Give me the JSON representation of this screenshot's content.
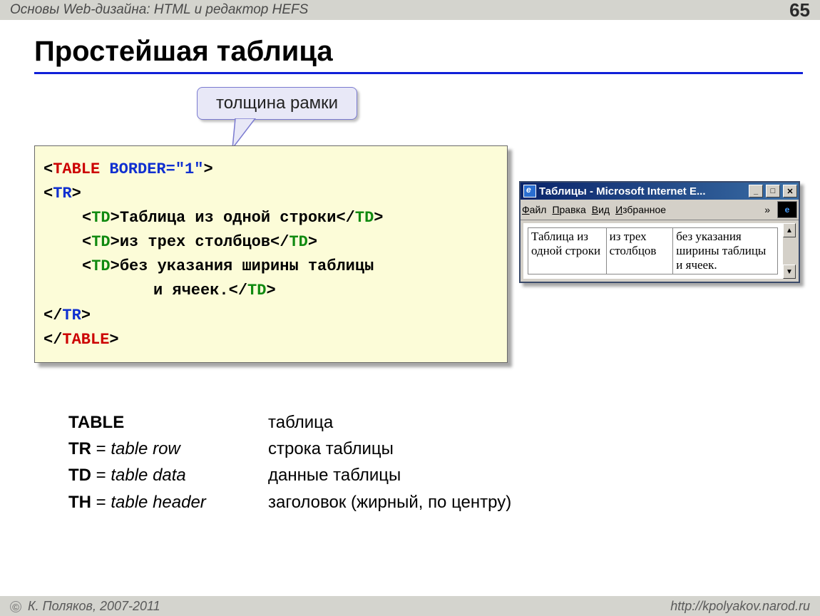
{
  "header": {
    "breadcrumb": "Основы Web-дизайна: HTML и редактор HEFS",
    "page_number": "65"
  },
  "title": "Простейшая таблица",
  "callout": "толщина рамки",
  "code": {
    "l1_a": "<TABLE",
    "l1_b": " BORDER=\"1\"",
    "l1_c": ">",
    "l2": "<TR>",
    "l3_a": "<TD>",
    "l3_b": "Таблица из одной строки",
    "l3_c": "</TD>",
    "l4_a": "<TD>",
    "l4_b": "из трех столбцов",
    "l4_c": "</TD>",
    "l5_a": "<TD>",
    "l5_b": "без указания ширины таблицы",
    "l6_b": "и ячеек.",
    "l6_c": "</TD>",
    "l7": "</TR>",
    "l8": "</TABLE>"
  },
  "ie": {
    "title": "Таблицы - Microsoft Internet E...",
    "menu": {
      "file": "Файл",
      "edit": "Правка",
      "view": "Вид",
      "fav": "Избранное",
      "chev": "»"
    },
    "cells": {
      "c1": "Таблица из одной строки",
      "c2": "из трех столбцов",
      "c3": "без указания ширины таблицы и ячеек."
    },
    "btn_min": "_",
    "btn_max": "□",
    "btn_close": "✕",
    "arrow_up": "▲",
    "arrow_down": "▼"
  },
  "defs": [
    {
      "tag": "TABLE",
      "eq": "",
      "eng": "",
      "ru": "таблица"
    },
    {
      "tag": "TR",
      "eq": " = ",
      "eng": "table row",
      "ru": "строка таблицы"
    },
    {
      "tag": "TD",
      "eq": " = ",
      "eng": "table data",
      "ru": "данные таблицы"
    },
    {
      "tag": "TH",
      "eq": " = ",
      "eng": "table header",
      "ru": "заголовок (жирный, по центру)"
    }
  ],
  "footer": {
    "copyright_symbol": "©",
    "author": " К. Поляков, 2007-2011",
    "url": "http://kpolyakov.narod.ru"
  }
}
